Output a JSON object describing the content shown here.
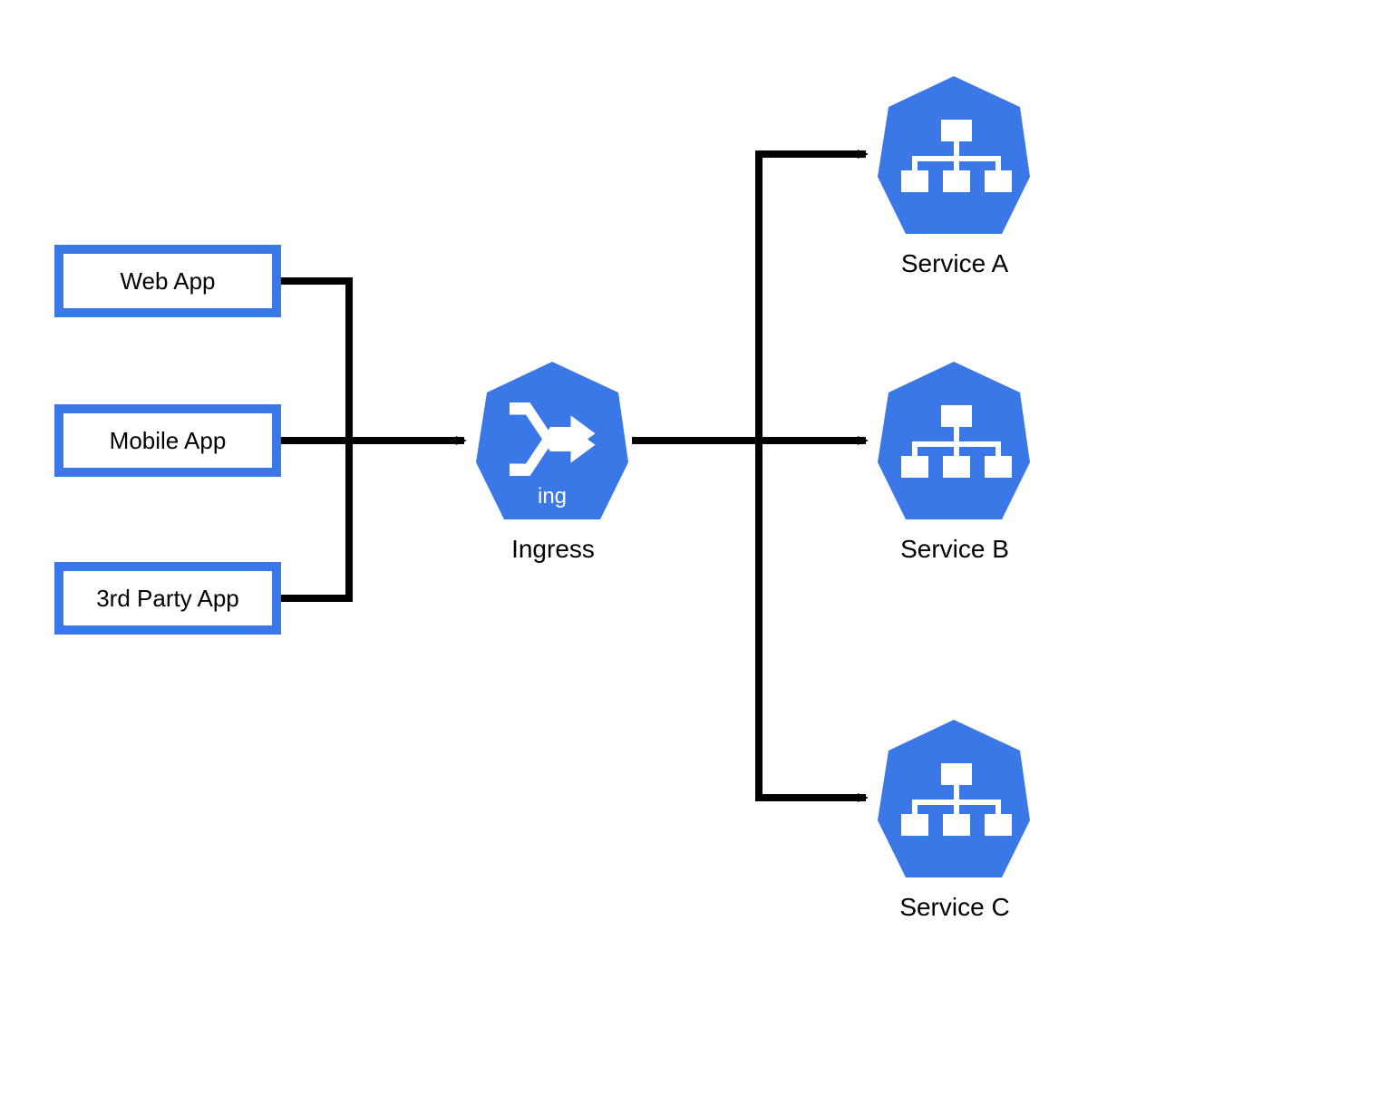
{
  "clients": [
    {
      "label": "Web App"
    },
    {
      "label": "Mobile App"
    },
    {
      "label": "3rd Party App"
    }
  ],
  "ingress": {
    "label": "Ingress",
    "icon_text": "ing"
  },
  "services": [
    {
      "label": "Service A"
    },
    {
      "label": "Service B"
    },
    {
      "label": "Service C"
    }
  ],
  "colors": {
    "brand_blue": "#3b78e7",
    "arrow_black": "#000000"
  }
}
